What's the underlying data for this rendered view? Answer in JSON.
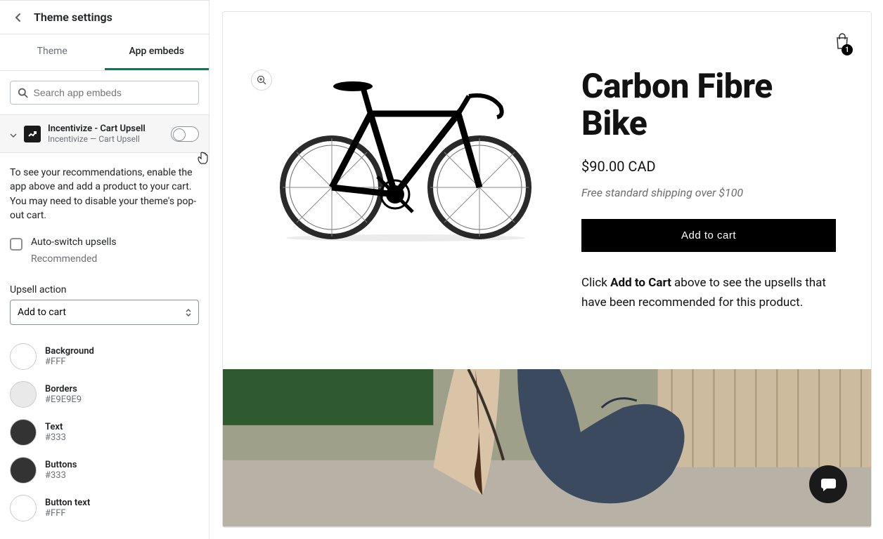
{
  "sidebar": {
    "title": "Theme settings",
    "tabs": {
      "theme": "Theme",
      "app_embeds": "App embeds"
    },
    "search_placeholder": "Search app embeds",
    "app": {
      "name": "Incentivize - Cart Upsell",
      "subtitle": "Incentivize — Cart Upsell",
      "enabled": false
    },
    "help_text": "To see your recommendations, enable the app above and add a product to your cart. You may need to disable your theme's pop-out cart.",
    "auto_switch": {
      "label": "Auto-switch upsells",
      "sub": "Recommended",
      "checked": false
    },
    "upsell_action": {
      "label": "Upsell action",
      "value": "Add to cart"
    },
    "colors": [
      {
        "name": "Background",
        "hex": "#FFF",
        "swatch": "#ffffff"
      },
      {
        "name": "Borders",
        "hex": "#E9E9E9",
        "swatch": "#e9e9e9"
      },
      {
        "name": "Text",
        "hex": "#333",
        "swatch": "#333333"
      },
      {
        "name": "Buttons",
        "hex": "#333",
        "swatch": "#333333"
      },
      {
        "name": "Button text",
        "hex": "#FFF",
        "swatch": "#ffffff"
      }
    ]
  },
  "preview": {
    "cart_count": "1",
    "product": {
      "title": "Carbon Fibre Bike",
      "price": "$90.00 CAD",
      "shipping": "Free standard shipping over $100",
      "add_to_cart": "Add to cart",
      "note_before": "Click ",
      "note_bold": "Add to Cart",
      "note_after": " above to see the upsells that have been recommended for this product."
    }
  }
}
